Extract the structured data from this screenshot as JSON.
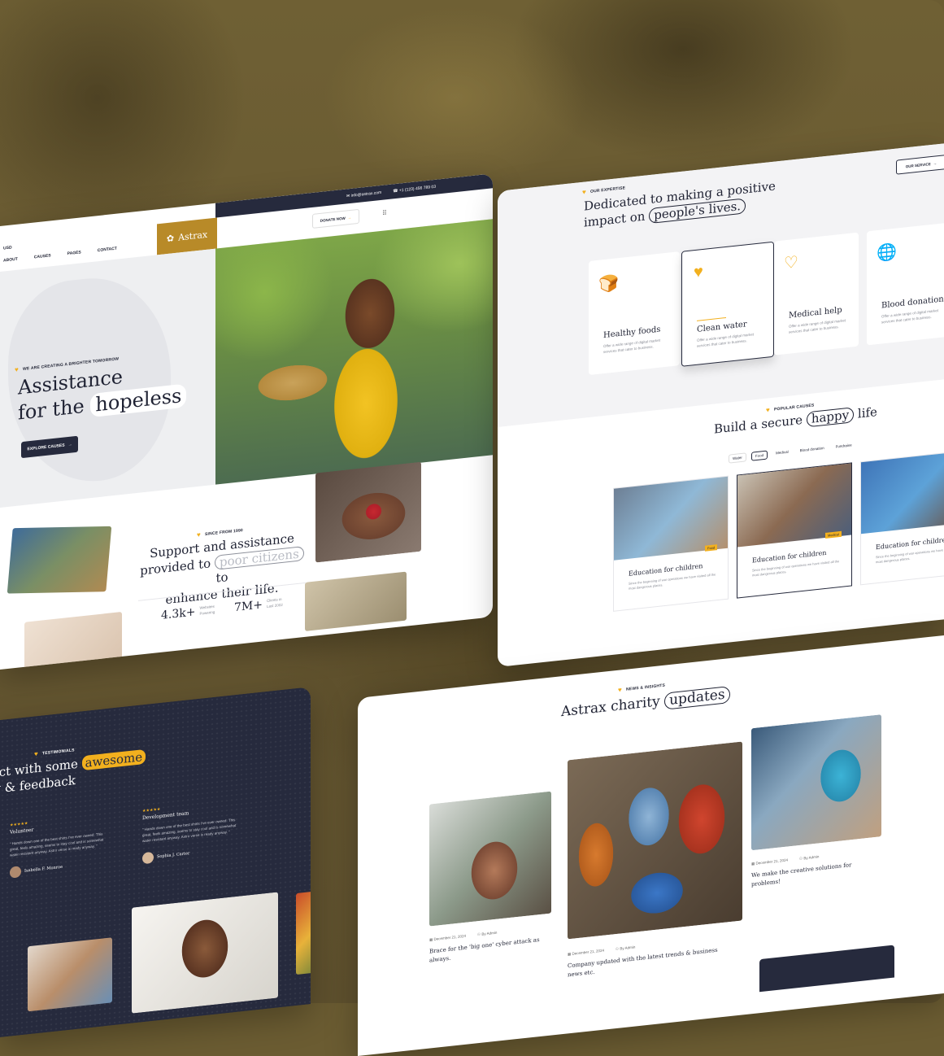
{
  "colors": {
    "accent": "#f2b01e",
    "dark": "#262a3d",
    "gold": "#b88a28"
  },
  "card1": {
    "topbar_email": "info@astrax.com",
    "topbar_phone": "+1 (123) 456 789 03",
    "currency": "USD",
    "nav": [
      "ABOUT",
      "CAUSES",
      "PAGES",
      "CONTACT"
    ],
    "logo": "Astrax",
    "donate": "DONATE NOW",
    "hero_tag": "WE ARE CREATING A BRIGHTER TOMORROW",
    "hero_line1": "Assistance",
    "hero_line2a": "for the",
    "hero_line2b": "hopeless",
    "hero_button": "EXPLORE CAUSES",
    "about_tag": "SINCE FROM 1990",
    "about_line1": "Support and assistance",
    "about_line2a": "provided to",
    "about_line2b": "poor citizens",
    "about_line2c": "to",
    "about_line3": "enhance their life.",
    "stat1_value": "4.3k+",
    "stat1_label": "Websites Powering",
    "stat2_value": "7M+",
    "stat2_label": "Clients in Last 2002"
  },
  "card2": {
    "tag": "OUR EXPERTISE",
    "title1": "Dedicated to making a positive",
    "title2a": "impact on",
    "title2b": "people's lives.",
    "service_button": "OUR SERVICE",
    "desc": "Offer a wide range of digital market services that cater to business.",
    "services": [
      "Healthy foods",
      "Clean water",
      "Medical help",
      "Blood donation"
    ],
    "causes_tag": "POPULAR CAUSES",
    "causes_title_a": "Build a secure",
    "causes_title_b": "happy",
    "causes_title_c": "life",
    "filters": [
      "Water",
      "Food",
      "Medical",
      "Blood donation",
      "Fundraise"
    ],
    "cause_cards": [
      {
        "title": "Education for children",
        "badge": "Food",
        "text": "Since the beginning of war operations we have visited all the most dangerous places."
      },
      {
        "title": "Education for children",
        "badge": "Medical",
        "text": "Since the beginning of war operations we have visited all the most dangerous places."
      },
      {
        "title": "Education for children",
        "badge": "",
        "text": "Since the beginning of war operations we have visited all the most dangerous places."
      }
    ]
  },
  "card3": {
    "tag": "TESTIMONIALS",
    "title_a": "Connect with some",
    "title_b": "awesome",
    "title_c": "review & feedback",
    "stars": "★★★★★",
    "reviews": [
      {
        "role": "Volunteer",
        "text": "“ Hands down one of the best shirts I've ever owned. This great, feels amazing, seems to stay cool and is somewhat water resistant anyway. Astro verse is ready anyway. ”",
        "name": "Isabella F. Monroe"
      },
      {
        "role": "Development team",
        "text": "“ Hands down one of the best shirts I've ever owned. This great, feels amazing, seems to stay cool and is somewhat water resistant anyway. Astro verse is ready anyway. ”",
        "name": "Sophia J. Carter"
      }
    ]
  },
  "card4": {
    "tag": "NEWS & INSIGHTS",
    "title_a": "Astrax charity",
    "title_b": "updates",
    "by": "By",
    "posts": [
      {
        "date": "December 21, 2024",
        "author": "Admin",
        "title": "Brace for the 'big one' cyber attack as always."
      },
      {
        "date": "December 21, 2024",
        "author": "Admin",
        "title": "Company updated with the latest trends & business news etc."
      },
      {
        "date": "December 21, 2024",
        "author": "Admin",
        "title": "We make the creative solutions for problems!"
      }
    ]
  }
}
